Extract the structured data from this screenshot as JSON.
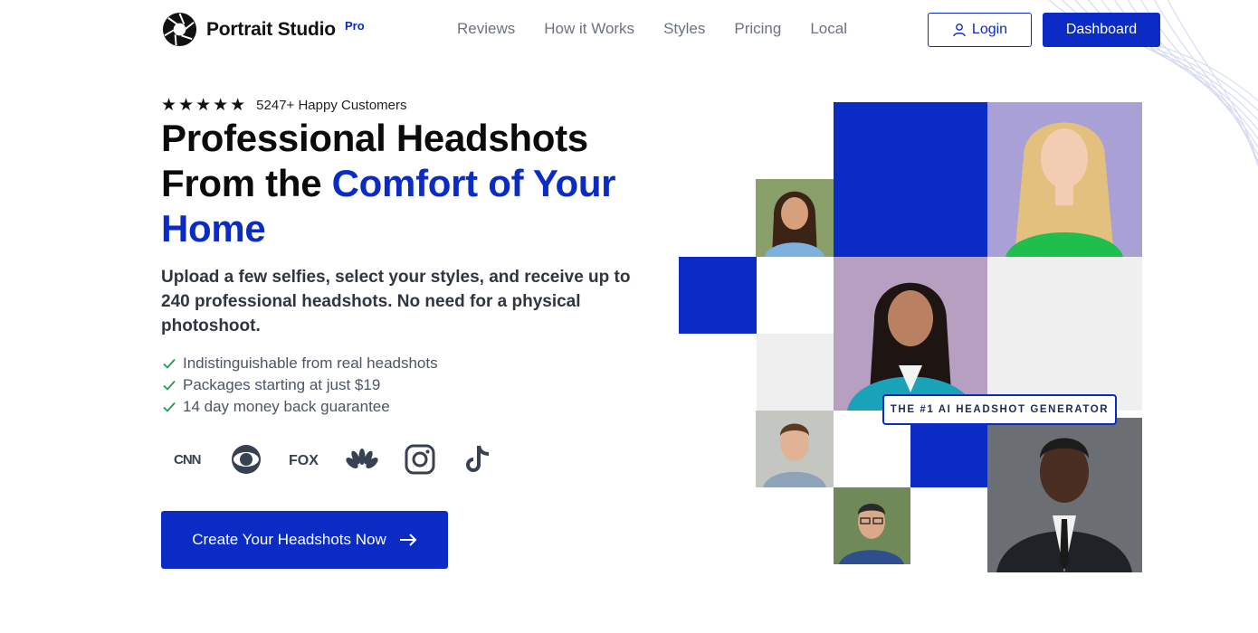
{
  "brand": {
    "name": "Portrait Studio",
    "badge": "Pro",
    "accent_color": "#0a2bc4"
  },
  "nav": {
    "items": [
      {
        "label": "Reviews"
      },
      {
        "label": "How it Works"
      },
      {
        "label": "Styles"
      },
      {
        "label": "Pricing"
      },
      {
        "label": "Local"
      }
    ],
    "login_label": "Login",
    "dashboard_label": "Dashboard"
  },
  "hero": {
    "stars": "★★★★★",
    "rating_count": 5,
    "customers_text": "5247+ Happy Customers",
    "headline_part1": "Professional Headshots",
    "headline_part2": "From the ",
    "headline_accent": "Comfort of Your Home",
    "subhead": "Upload a few selfies, select your styles, and receive up to 240 professional headshots. No need for a physical photoshoot.",
    "features": [
      "Indistinguishable from real headshots",
      "Packages starting at just $19",
      "14 day money back guarantee"
    ],
    "press_logos": [
      "cnn-logo",
      "cbs-logo",
      "fox-logo",
      "nbc-logo",
      "instagram-icon",
      "tiktok-icon"
    ],
    "cta_label": "Create Your Headshots Now"
  },
  "collage": {
    "badge_text": "THE #1 AI HEADSHOT GENERATOR"
  }
}
